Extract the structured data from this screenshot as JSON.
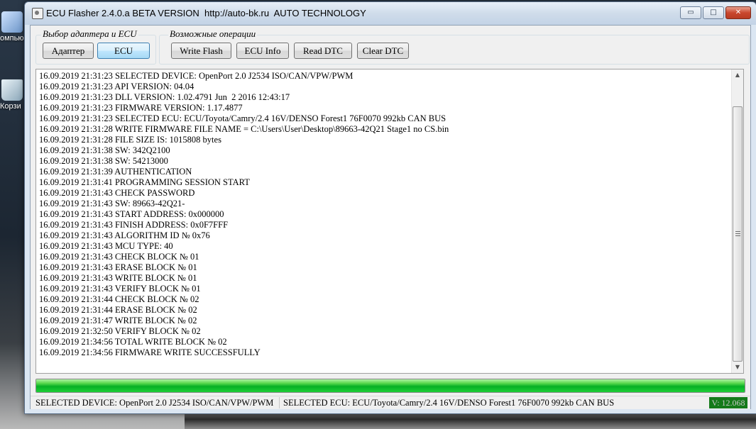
{
  "desktop": {
    "icons": [
      {
        "label": "омпьюг"
      },
      {
        "label": "Корзи"
      }
    ]
  },
  "window": {
    "title": "ECU Flasher 2.4.0.a BETA VERSION  http://auto-bk.ru  AUTO TECHNOLOGY",
    "caption_buttons": {
      "minimize": "▭",
      "maximize": "□",
      "close": "✕"
    }
  },
  "groups": {
    "adapter": {
      "legend": "Выбор адаптера и ECU",
      "adapter_button": "Адаптер",
      "ecu_button": "ECU"
    },
    "operations": {
      "legend": "Возможные операции",
      "write_flash": "Write Flash",
      "ecu_info": "ECU Info",
      "read_dtc": "Read DTC",
      "clear_dtc": "Clear DTC"
    }
  },
  "log": {
    "lines": [
      "16.09.2019 21:31:23 SELECTED DEVICE: OpenPort 2.0 J2534 ISO/CAN/VPW/PWM",
      "16.09.2019 21:31:23 API VERSION: 04.04",
      "16.09.2019 21:31:23 DLL VERSION: 1.02.4791 Jun  2 2016 12:43:17",
      "16.09.2019 21:31:23 FIRMWARE VERSION: 1.17.4877",
      "16.09.2019 21:31:23 SELECTED ECU: ECU/Toyota/Camry/2.4 16V/DENSO Forest1 76F0070 992kb CAN BUS",
      "16.09.2019 21:31:28 WRITE FIRMWARE FILE NAME = C:\\Users\\User\\Desktop\\89663-42Q21 Stage1 no CS.bin",
      "16.09.2019 21:31:28 FILE SIZE IS: 1015808 bytes",
      "16.09.2019 21:31:38 SW: 342Q2100",
      "16.09.2019 21:31:38 SW: 54213000",
      "16.09.2019 21:31:39 AUTHENTICATION",
      "16.09.2019 21:31:41 PROGRAMMING SESSION START",
      "16.09.2019 21:31:43 CHECK PASSWORD",
      "16.09.2019 21:31:43 SW: 89663-42Q21-",
      "16.09.2019 21:31:43 START ADDRESS: 0x000000",
      "16.09.2019 21:31:43 FINISH ADDRESS: 0x0F7FFF",
      "16.09.2019 21:31:43 ALGORITHM ID № 0x76",
      "16.09.2019 21:31:43 MCU TYPE: 40",
      "16.09.2019 21:31:43 CHECK BLOCK № 01",
      "16.09.2019 21:31:43 ERASE BLOCK № 01",
      "16.09.2019 21:31:43 WRITE BLOCK № 01",
      "16.09.2019 21:31:43 VERIFY BLOCK № 01",
      "16.09.2019 21:31:44 CHECK BLOCK № 02",
      "16.09.2019 21:31:44 ERASE BLOCK № 02",
      "16.09.2019 21:31:47 WRITE BLOCK № 02",
      "16.09.2019 21:32:50 VERIFY BLOCK № 02",
      "16.09.2019 21:34:56 TOTAL WRITE BLOCK № 02",
      "16.09.2019 21:34:56 FIRMWARE WRITE SUCCESSFULLY"
    ],
    "scroll_up_icon": "▲",
    "scroll_down_icon": "▼"
  },
  "progress": {
    "fraction": 1.0,
    "color": "#06b025"
  },
  "statusbar": {
    "device": "SELECTED DEVICE: OpenPort 2.0 J2534 ISO/CAN/VPW/PWM",
    "ecu": "SELECTED ECU: ECU/Toyota/Camry/2.4 16V/DENSO Forest1 76F0070 992kb CAN BUS",
    "version": "V: 12.068",
    "version_bg": "#147a1a"
  }
}
